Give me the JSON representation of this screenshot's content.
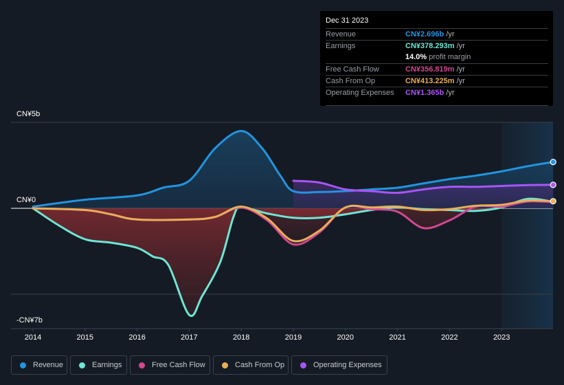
{
  "tooltip": {
    "date": "Dec 31 2023",
    "rows": [
      {
        "label": "Revenue",
        "value": "CN¥2.696b",
        "unit": " /yr",
        "color": "#2394df"
      },
      {
        "label": "Earnings",
        "value": "CN¥378.293m",
        "unit": " /yr",
        "color": "#6ee6d4"
      },
      {
        "label": "",
        "value": "14.0%",
        "unit": " profit margin",
        "color": "#ffffff"
      },
      {
        "label": "Free Cash Flow",
        "value": "CN¥356.819m",
        "unit": " /yr",
        "color": "#d1488f"
      },
      {
        "label": "Cash From Op",
        "value": "CN¥413.225m",
        "unit": " /yr",
        "color": "#e8ae5a"
      },
      {
        "label": "Operating Expenses",
        "value": "CN¥1.365b",
        "unit": " /yr",
        "color": "#a855f7"
      }
    ]
  },
  "chart_data": {
    "type": "line",
    "title": "",
    "xlabel": "",
    "ylabel": "",
    "y_unit": "CN¥ billions",
    "ylim": [
      -7,
      5
    ],
    "xlim": [
      2014,
      2024
    ],
    "y_tick_labels": [
      {
        "value": 5,
        "label": "CN¥5b"
      },
      {
        "value": 0,
        "label": "CN¥0"
      },
      {
        "value": -7,
        "label": "-CN¥7b"
      }
    ],
    "gridlines": [
      5,
      0,
      -5
    ],
    "x_tick_labels": [
      "2014",
      "2015",
      "2016",
      "2017",
      "2018",
      "2019",
      "2020",
      "2021",
      "2022",
      "2023"
    ],
    "x_ticks": [
      2014,
      2015,
      2016,
      2017,
      2018,
      2019,
      2020,
      2021,
      2022,
      2023
    ],
    "forecast_shade_start": 2023,
    "legend_position": "bottom",
    "series": [
      {
        "name": "Revenue",
        "color": "#2394df",
        "points": [
          [
            2014,
            0.1
          ],
          [
            2015,
            0.5
          ],
          [
            2016,
            0.75
          ],
          [
            2016.5,
            1.2
          ],
          [
            2017,
            1.6
          ],
          [
            2017.5,
            3.5
          ],
          [
            2018,
            4.5
          ],
          [
            2018.4,
            3.5
          ],
          [
            2018.75,
            1.9
          ],
          [
            2019,
            1.0
          ],
          [
            2019.5,
            0.95
          ],
          [
            2020,
            1.0
          ],
          [
            2020.5,
            1.1
          ],
          [
            2021,
            1.2
          ],
          [
            2021.5,
            1.45
          ],
          [
            2022,
            1.7
          ],
          [
            2022.5,
            1.9
          ],
          [
            2023,
            2.15
          ],
          [
            2023.5,
            2.45
          ],
          [
            2023.99,
            2.696
          ]
        ]
      },
      {
        "name": "Earnings",
        "color": "#6ee6d4",
        "points": [
          [
            2014,
            0
          ],
          [
            2014.5,
            -1.0
          ],
          [
            2015,
            -1.8
          ],
          [
            2015.5,
            -2.0
          ],
          [
            2016,
            -2.3
          ],
          [
            2016.3,
            -2.8
          ],
          [
            2016.6,
            -3.3
          ],
          [
            2017,
            -6.2
          ],
          [
            2017.25,
            -5.1
          ],
          [
            2017.6,
            -3.1
          ],
          [
            2017.85,
            -0.5
          ],
          [
            2018,
            0.05
          ],
          [
            2018.5,
            -0.3
          ],
          [
            2019,
            -0.55
          ],
          [
            2019.5,
            -0.55
          ],
          [
            2020,
            -0.35
          ],
          [
            2020.5,
            -0.1
          ],
          [
            2021,
            0.05
          ],
          [
            2021.5,
            -0.05
          ],
          [
            2022,
            -0.1
          ],
          [
            2022.5,
            -0.15
          ],
          [
            2023,
            0.05
          ],
          [
            2023.5,
            0.55
          ],
          [
            2023.99,
            0.378
          ]
        ]
      },
      {
        "name": "Free Cash Flow",
        "color": "#d1488f",
        "points": [
          [
            2014,
            0
          ],
          [
            2015,
            -0.1
          ],
          [
            2015.5,
            -0.35
          ],
          [
            2016,
            -0.65
          ],
          [
            2017,
            -0.65
          ],
          [
            2017.5,
            -0.5
          ],
          [
            2018,
            0.05
          ],
          [
            2018.5,
            -0.7
          ],
          [
            2019,
            -2.1
          ],
          [
            2019.5,
            -1.4
          ],
          [
            2020,
            0.05
          ],
          [
            2020.5,
            -0.05
          ],
          [
            2021,
            -0.2
          ],
          [
            2021.5,
            -1.15
          ],
          [
            2022,
            -0.7
          ],
          [
            2022.5,
            0.1
          ],
          [
            2023,
            0.1
          ],
          [
            2023.5,
            0.4
          ],
          [
            2023.99,
            0.357
          ]
        ]
      },
      {
        "name": "Cash From Op",
        "color": "#e8ae5a",
        "points": [
          [
            2014,
            0
          ],
          [
            2015,
            -0.1
          ],
          [
            2015.5,
            -0.35
          ],
          [
            2016,
            -0.65
          ],
          [
            2017,
            -0.65
          ],
          [
            2017.5,
            -0.5
          ],
          [
            2018,
            0.1
          ],
          [
            2018.5,
            -0.6
          ],
          [
            2019,
            -1.9
          ],
          [
            2019.5,
            -1.3
          ],
          [
            2020,
            0.05
          ],
          [
            2020.5,
            0.05
          ],
          [
            2021,
            0.1
          ],
          [
            2021.5,
            -0.1
          ],
          [
            2022,
            -0.05
          ],
          [
            2022.5,
            0.15
          ],
          [
            2023,
            0.2
          ],
          [
            2023.5,
            0.45
          ],
          [
            2023.99,
            0.413
          ]
        ]
      },
      {
        "name": "Operating Expenses",
        "color": "#a855f7",
        "points": [
          [
            2019,
            1.6
          ],
          [
            2019.5,
            1.5
          ],
          [
            2020,
            1.1
          ],
          [
            2020.5,
            1.0
          ],
          [
            2021,
            0.9
          ],
          [
            2021.5,
            1.1
          ],
          [
            2022,
            1.25
          ],
          [
            2022.5,
            1.25
          ],
          [
            2023,
            1.3
          ],
          [
            2023.5,
            1.35
          ],
          [
            2023.99,
            1.365
          ]
        ]
      }
    ]
  },
  "legend": [
    {
      "label": "Revenue",
      "color": "#2394df"
    },
    {
      "label": "Earnings",
      "color": "#6ee6d4"
    },
    {
      "label": "Free Cash Flow",
      "color": "#d1488f"
    },
    {
      "label": "Cash From Op",
      "color": "#e8ae5a"
    },
    {
      "label": "Operating Expenses",
      "color": "#a855f7"
    }
  ]
}
